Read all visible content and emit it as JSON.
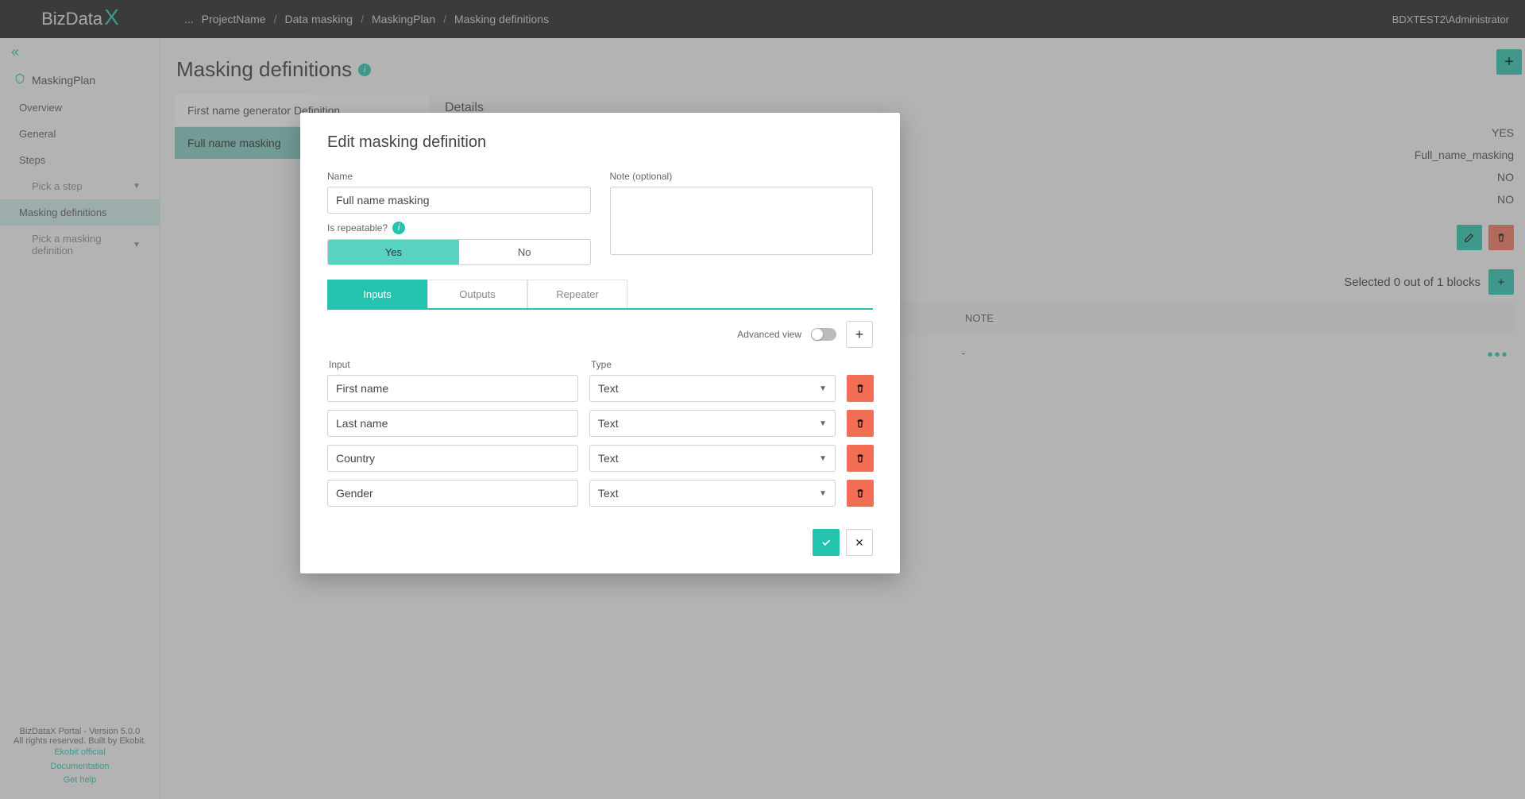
{
  "app": {
    "logo_a": "BizData",
    "logo_b": "X",
    "user": "BDXTEST2\\Administrator"
  },
  "breadcrumb": {
    "ellipsis": "...",
    "items": [
      "ProjectName",
      "Data masking",
      "MaskingPlan",
      "Masking definitions"
    ]
  },
  "sidebar": {
    "plan": "MaskingPlan",
    "items": {
      "overview": "Overview",
      "general": "General",
      "steps": "Steps",
      "pick_step": "Pick a step",
      "masking_defs": "Masking definitions",
      "pick_def": "Pick a masking definition"
    },
    "footer": {
      "version": "BizDataX Portal - Version 5.0.0",
      "rights": "All rights reserved. Built by Ekobit.",
      "links": {
        "official": "Ekobit official",
        "docs": "Documentation",
        "help": "Get help"
      }
    }
  },
  "page": {
    "title": "Masking definitions"
  },
  "definitions": {
    "items": [
      {
        "name": "First name generator Definition"
      },
      {
        "name": "Full name masking"
      }
    ]
  },
  "details": {
    "title": "Details",
    "rows": {
      "r1": "YES",
      "r2": "Full_name_masking",
      "r3": "NO",
      "r4": "NO"
    }
  },
  "blocks": {
    "summary": "Selected 0 out of 1 blocks",
    "note_header": "NOTE",
    "note_value": "-"
  },
  "modal": {
    "title": "Edit masking definition",
    "labels": {
      "name": "Name",
      "note": "Note (optional)",
      "repeatable": "Is repeatable?",
      "yes": "Yes",
      "no": "No",
      "adv": "Advanced view",
      "input": "Input",
      "type": "Type"
    },
    "name_value": "Full name masking",
    "note_value": "",
    "tabs": {
      "inputs": "Inputs",
      "outputs": "Outputs",
      "repeater": "Repeater"
    },
    "inputs": [
      {
        "name": "First name",
        "type": "Text"
      },
      {
        "name": "Last name",
        "type": "Text"
      },
      {
        "name": "Country",
        "type": "Text"
      },
      {
        "name": "Gender",
        "type": "Text"
      }
    ]
  }
}
